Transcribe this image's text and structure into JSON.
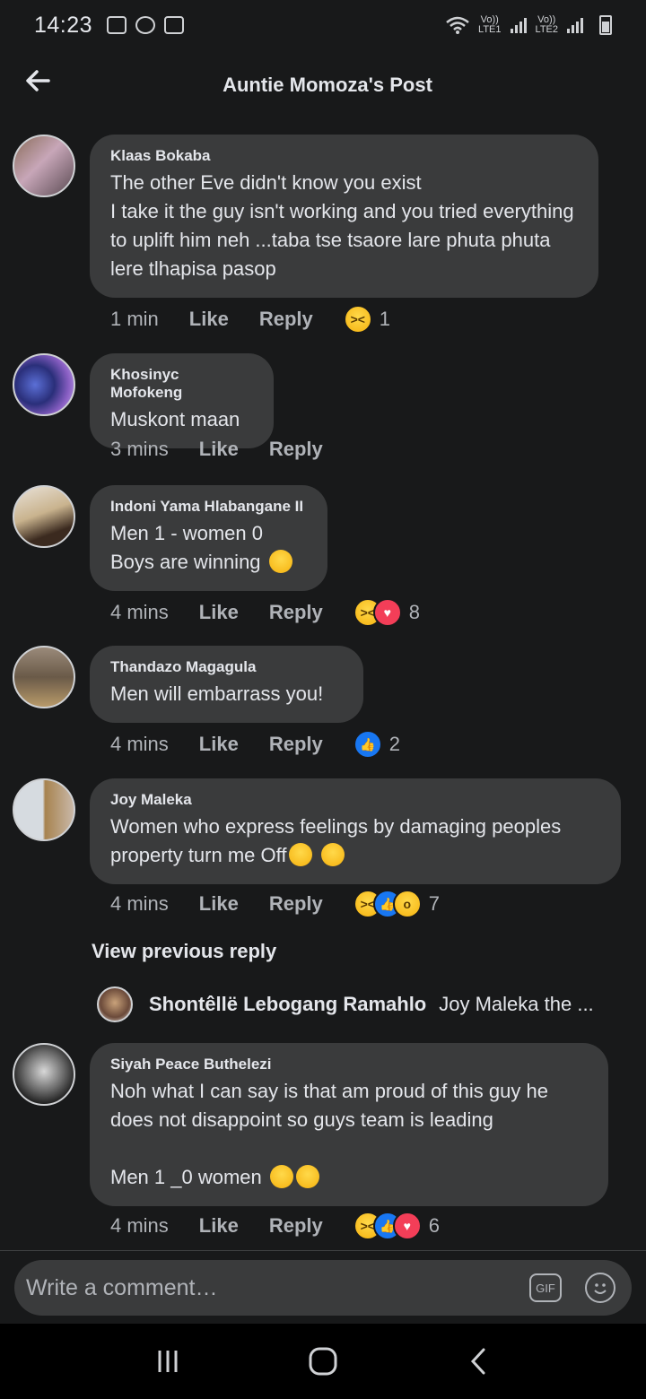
{
  "status": {
    "time": "14:23",
    "sim1": "LTE1",
    "sim2": "LTE2",
    "volte1": "Vo))",
    "volte2": "Vo))"
  },
  "header": {
    "title": "Auntie Momoza's Post"
  },
  "comments": [
    {
      "author": "Klaas Bokaba",
      "text": "The other Eve didn't know you exist\nI take it the guy isn't working and you tried everything to uplift him neh ...taba tse tsaore lare phuta phuta lere tlhapisa pasop",
      "time": "1 min",
      "like": "Like",
      "reply": "Reply",
      "reactions": [
        "haha"
      ],
      "reaction_count": "1"
    },
    {
      "author": "Khosinyc Mofokeng",
      "text": "Muskont maan",
      "time": "3 mins",
      "like": "Like",
      "reply": "Reply"
    },
    {
      "author": "Indoni Yama Hlabangane II",
      "line1": "Men 1 - women 0",
      "line2": "Boys are winning",
      "time": "4 mins",
      "like": "Like",
      "reply": "Reply",
      "reactions": [
        "haha",
        "love"
      ],
      "reaction_count": "8"
    },
    {
      "author": "Thandazo Magagula",
      "text": "Men will embarrass you!",
      "time": "4 mins",
      "like": "Like",
      "reply": "Reply",
      "reactions": [
        "like"
      ],
      "reaction_count": "2"
    },
    {
      "author": "Joy Maleka",
      "line1": "Women who express feelings by damaging peoples",
      "line2": "property turn me Off",
      "time": "4 mins",
      "like": "Like",
      "reply": "Reply",
      "reactions": [
        "haha",
        "like",
        "wow"
      ],
      "reaction_count": "7"
    },
    {
      "author": "Siyah Peace Buthelezi",
      "text": "Noh what I can say is that am proud of this guy he does not disappoint so guys team is leading",
      "line_last": "Men 1 _0 women",
      "time": "4 mins",
      "like": "Like",
      "reply": "Reply",
      "reactions": [
        "haha",
        "like",
        "love"
      ],
      "reaction_count": "6"
    }
  ],
  "view_previous": "View previous reply",
  "reply_preview": {
    "author": "Shontêllë Lebogang Ramahlo",
    "text": "Joy Maleka the ..."
  },
  "composer": {
    "placeholder": "Write a comment…",
    "gif_label": "GIF"
  },
  "colors": {
    "background": "#18191a",
    "bubble": "#3a3b3c",
    "like_blue": "#1877f2",
    "love_red": "#f33e58",
    "haha_yellow": "#f7b928"
  }
}
